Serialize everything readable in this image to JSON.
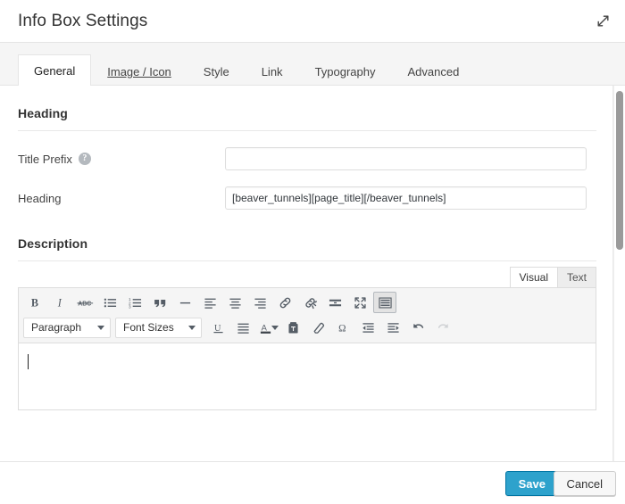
{
  "window": {
    "title": "Info Box Settings",
    "expand_icon": "expand-diagonal-icon"
  },
  "tabs": [
    {
      "label": "General",
      "state": "active"
    },
    {
      "label": "Image / Icon",
      "state": "hover"
    },
    {
      "label": "Style",
      "state": "normal"
    },
    {
      "label": "Link",
      "state": "normal"
    },
    {
      "label": "Typography",
      "state": "normal"
    },
    {
      "label": "Advanced",
      "state": "normal"
    }
  ],
  "sections": {
    "heading": {
      "title": "Heading",
      "fields": {
        "title_prefix": {
          "label": "Title Prefix",
          "value": "",
          "placeholder": "",
          "help_icon": "question-mark-circle-icon"
        },
        "heading": {
          "label": "Heading",
          "value": "[beaver_tunnels][page_title][/beaver_tunnels]",
          "placeholder": ""
        }
      }
    },
    "description": {
      "title": "Description",
      "editor": {
        "mode_tabs": [
          {
            "label": "Visual",
            "state": "active"
          },
          {
            "label": "Text",
            "state": "normal"
          }
        ],
        "content": "",
        "toolbar_row1": [
          {
            "name": "bold-icon",
            "title": "Bold",
            "state": "normal"
          },
          {
            "name": "italic-icon",
            "title": "Italic",
            "state": "normal"
          },
          {
            "name": "strikethrough-icon",
            "title": "Strikethrough",
            "state": "normal"
          },
          {
            "name": "bullet-list-icon",
            "title": "Bulleted list",
            "state": "normal"
          },
          {
            "name": "numbered-list-icon",
            "title": "Numbered list",
            "state": "normal"
          },
          {
            "name": "blockquote-icon",
            "title": "Blockquote",
            "state": "normal"
          },
          {
            "name": "horizontal-rule-icon",
            "title": "Horizontal line",
            "state": "normal"
          },
          {
            "name": "align-left-icon",
            "title": "Align left",
            "state": "normal"
          },
          {
            "name": "align-center-icon",
            "title": "Align center",
            "state": "normal"
          },
          {
            "name": "align-right-icon",
            "title": "Align right",
            "state": "normal"
          },
          {
            "name": "link-icon",
            "title": "Insert link",
            "state": "normal"
          },
          {
            "name": "unlink-icon",
            "title": "Remove link",
            "state": "normal"
          },
          {
            "name": "read-more-icon",
            "title": "Insert Read More tag",
            "state": "normal"
          },
          {
            "name": "fullscreen-icon",
            "title": "Fullscreen",
            "state": "normal"
          },
          {
            "name": "toolbar-toggle-icon",
            "title": "Toolbar Toggle",
            "state": "active"
          }
        ],
        "toolbar_row2": [
          {
            "name": "underline-icon",
            "title": "Underline",
            "state": "normal"
          },
          {
            "name": "align-justify-icon",
            "title": "Justify",
            "state": "normal"
          },
          {
            "name": "text-color-icon",
            "title": "Text color",
            "state": "normal"
          },
          {
            "name": "text-color-caret-icon",
            "title": "Text color options",
            "state": "normal"
          },
          {
            "name": "paste-as-text-icon",
            "title": "Paste as text",
            "state": "normal"
          },
          {
            "name": "clear-formatting-icon",
            "title": "Clear formatting",
            "state": "normal"
          },
          {
            "name": "special-character-icon",
            "title": "Special character",
            "state": "normal"
          },
          {
            "name": "outdent-icon",
            "title": "Decrease indent",
            "state": "normal"
          },
          {
            "name": "indent-icon",
            "title": "Increase indent",
            "state": "normal"
          },
          {
            "name": "undo-icon",
            "title": "Undo",
            "state": "normal"
          },
          {
            "name": "redo-icon",
            "title": "Redo",
            "state": "disabled"
          }
        ],
        "format_select": {
          "label": "Paragraph"
        },
        "fontsize_select": {
          "label": "Font Sizes"
        }
      }
    }
  },
  "footer": {
    "save_label": "Save",
    "cancel_label": "Cancel"
  },
  "colors": {
    "accent": "#2ea2cc",
    "accent_border": "#0074a2",
    "panel_bg": "#ffffff",
    "tabbar_bg": "#f5f5f5",
    "toolbar_bg": "#f5f5f5",
    "border": "#e5e5e5",
    "icon": "#555d66",
    "scrollbar": "#9a9a9a"
  }
}
